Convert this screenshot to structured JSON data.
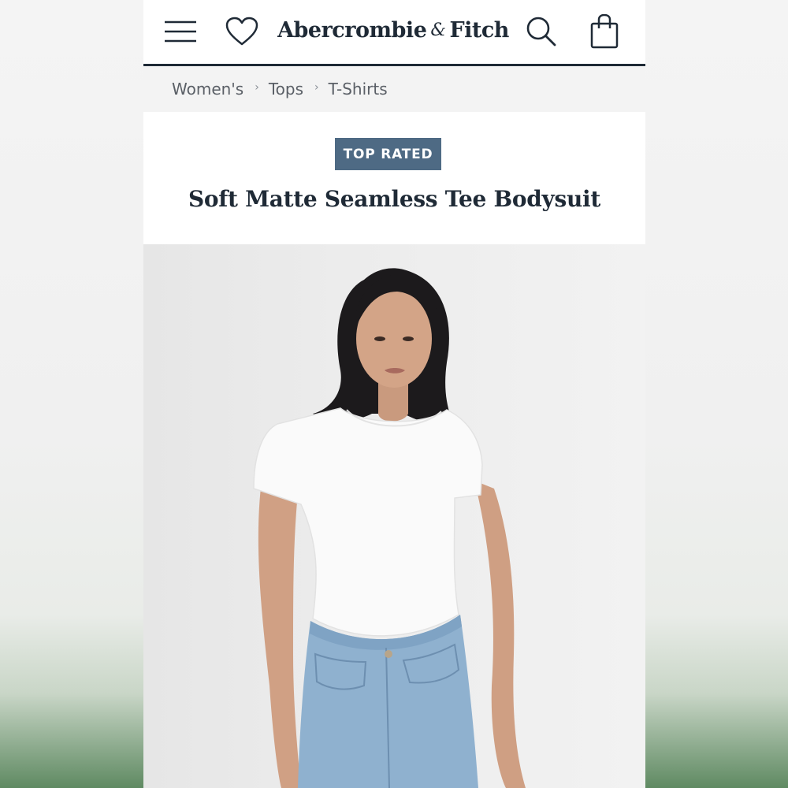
{
  "header": {
    "brand_part1": "Abercrombie",
    "brand_amp": "&",
    "brand_part2": "Fitch",
    "icons": [
      "menu-icon",
      "heart-icon",
      "search-icon",
      "shopping-bag-icon"
    ]
  },
  "breadcrumb": {
    "items": [
      {
        "label": "Women's"
      },
      {
        "label": "Tops"
      },
      {
        "label": "T-Shirts"
      }
    ],
    "separator": "›"
  },
  "product": {
    "badge": "TOP RATED",
    "title": "Soft Matte Seamless Tee Bodysuit"
  },
  "colors": {
    "brand_navy": "#1f2a36",
    "badge_blue": "#4e6a84",
    "breadcrumb_bg": "#f3f3f3"
  }
}
